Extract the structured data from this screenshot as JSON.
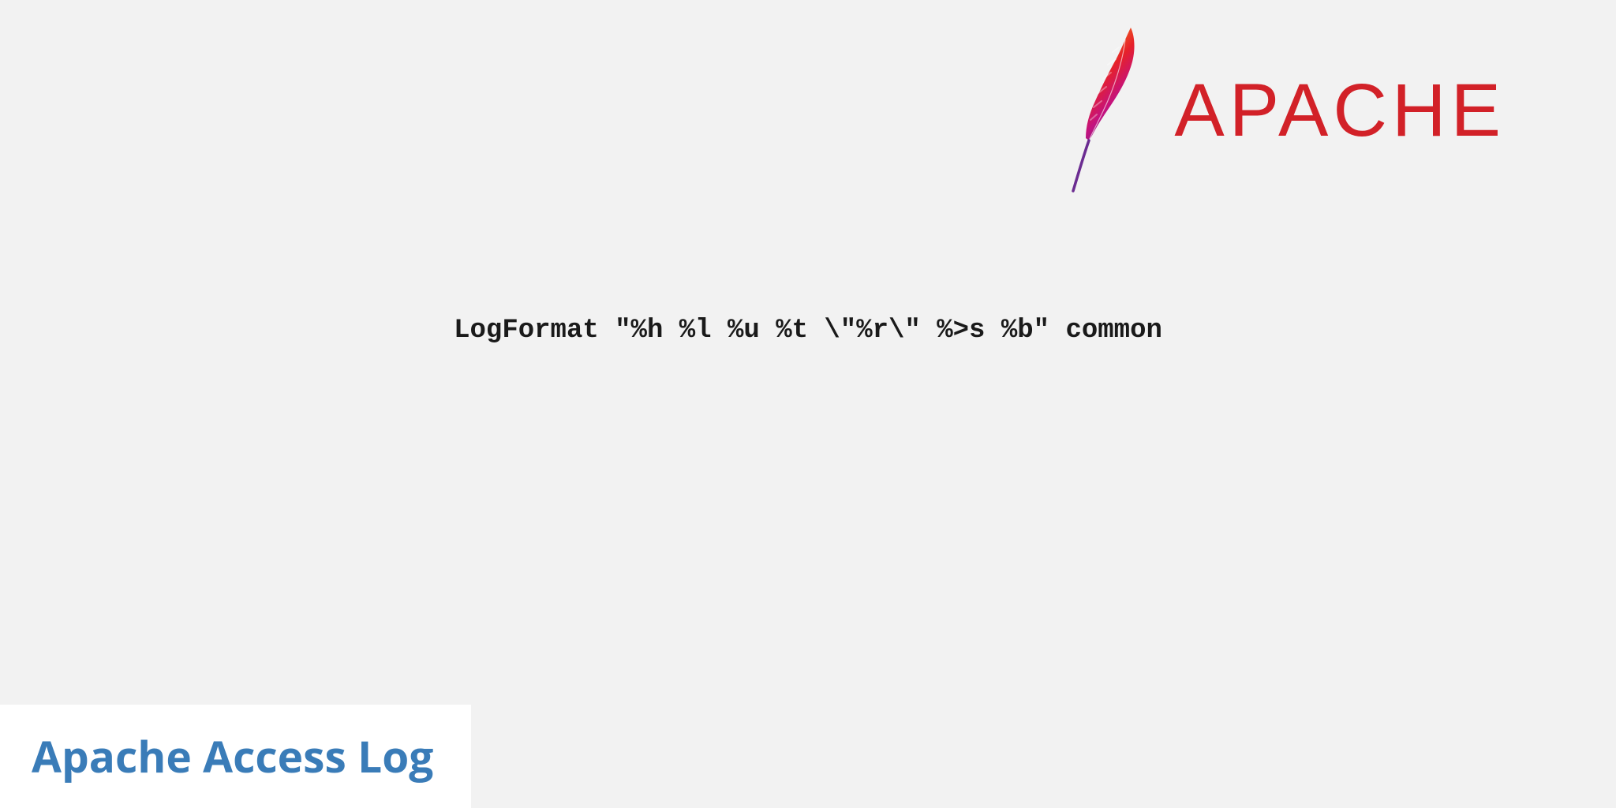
{
  "logo": {
    "brand": "APACHE"
  },
  "code": "LogFormat \"%h %l %u %t \\\"%r\\\" %>s %b\" common",
  "title": "Apache Access Log"
}
